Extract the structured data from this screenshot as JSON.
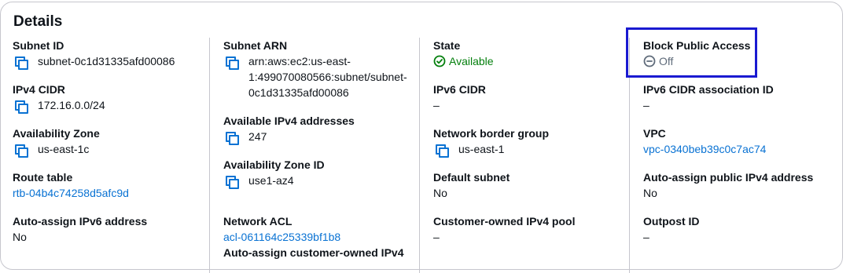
{
  "panel": {
    "title": "Details"
  },
  "col1": {
    "subnet_id": {
      "label": "Subnet ID",
      "value": "subnet-0c1d31335afd00086"
    },
    "ipv4_cidr": {
      "label": "IPv4 CIDR",
      "value": "172.16.0.0/24"
    },
    "availability_zone": {
      "label": "Availability Zone",
      "value": "us-east-1c"
    },
    "route_table": {
      "label": "Route table",
      "value": "rtb-04b4c74258d5afc9d"
    },
    "auto_ipv6": {
      "label": "Auto-assign IPv6 address",
      "value": "No"
    }
  },
  "col2": {
    "subnet_arn": {
      "label": "Subnet ARN",
      "value": "arn:aws:ec2:us-east-1:499070080566:subnet/subnet-0c1d31335afd00086"
    },
    "available_ipv4": {
      "label": "Available IPv4 addresses",
      "value": "247"
    },
    "az_id": {
      "label": "Availability Zone ID",
      "value": "use1-az4"
    },
    "network_acl": {
      "label": "Network ACL",
      "value": "acl-061164c25339bf1b8"
    },
    "auto_customer": {
      "label": "Auto-assign customer-owned IPv4"
    }
  },
  "col3": {
    "state": {
      "label": "State",
      "value": "Available"
    },
    "ipv6_cidr": {
      "label": "IPv6 CIDR",
      "value": "–"
    },
    "border_group": {
      "label": "Network border group",
      "value": "us-east-1"
    },
    "default_subnet": {
      "label": "Default subnet",
      "value": "No"
    },
    "customer_pool": {
      "label": "Customer-owned IPv4 pool",
      "value": "–"
    }
  },
  "col4": {
    "block_public": {
      "label": "Block Public Access",
      "value": "Off"
    },
    "ipv6_assoc": {
      "label": "IPv6 CIDR association ID",
      "value": "–"
    },
    "vpc": {
      "label": "VPC",
      "value": "vpc-0340beb39c0c7ac74"
    },
    "auto_public_ipv4": {
      "label": "Auto-assign public IPv4 address",
      "value": "No"
    },
    "outpost": {
      "label": "Outpost ID",
      "value": "–"
    }
  },
  "colors": {
    "link": "#0972d3",
    "success": "#037f0c",
    "muted": "#5f6b7a",
    "highlight": "#1a1ad1"
  }
}
